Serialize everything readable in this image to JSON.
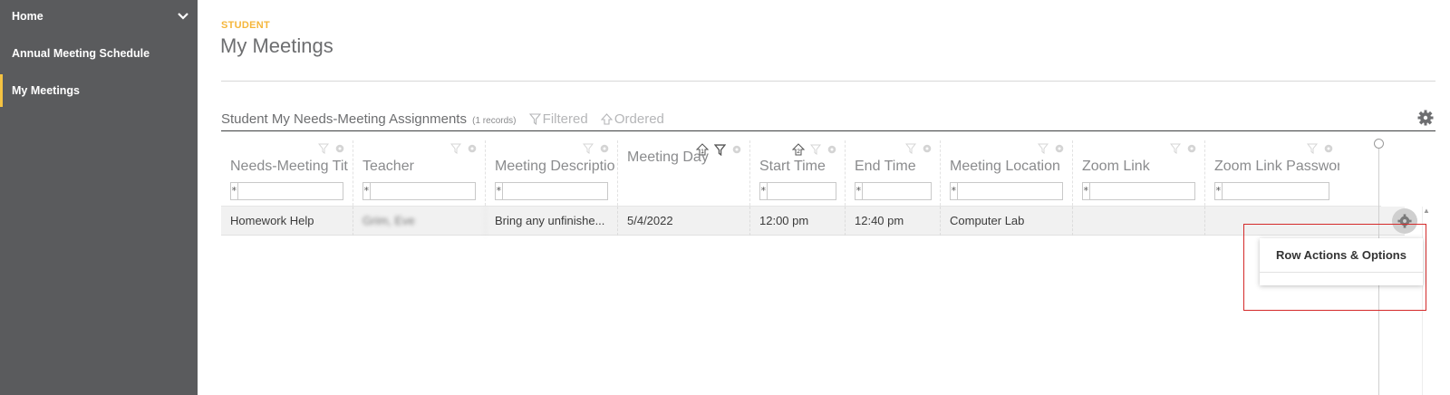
{
  "sidebar": {
    "items": [
      {
        "label": "Home"
      },
      {
        "label": "Annual Meeting Schedule"
      },
      {
        "label": "My Meetings"
      }
    ]
  },
  "page": {
    "eyebrow": "STUDENT",
    "title": "My Meetings"
  },
  "grid": {
    "title": "Student My Needs-Meeting Assignments",
    "records": "(1 records)",
    "filtered_label": "Filtered",
    "ordered_label": "Ordered",
    "filter_operator": "*",
    "columns": [
      {
        "label": "Needs-Meeting Title"
      },
      {
        "label": "Teacher"
      },
      {
        "label": "Meeting Description"
      },
      {
        "label": "Meeting Day",
        "sort_order": "1"
      },
      {
        "label": "Start Time",
        "sort_order": "2"
      },
      {
        "label": "End Time"
      },
      {
        "label": "Meeting Location"
      },
      {
        "label": "Zoom Link"
      },
      {
        "label": "Zoom Link Password"
      }
    ],
    "rows": [
      {
        "title": "Homework Help",
        "teacher": "Grim, Eve",
        "description": "Bring any unfinishe...",
        "day": "5/4/2022",
        "start": "12:00 pm",
        "end": "12:40 pm",
        "location": "Computer Lab",
        "zoom_link": "",
        "zoom_password": ""
      }
    ]
  },
  "row_menu": {
    "title": "Row Actions & Options"
  },
  "colors": {
    "sidebar_bg": "#5a5b5d",
    "accent": "#f5c342",
    "highlight_border": "#d42a2a"
  }
}
